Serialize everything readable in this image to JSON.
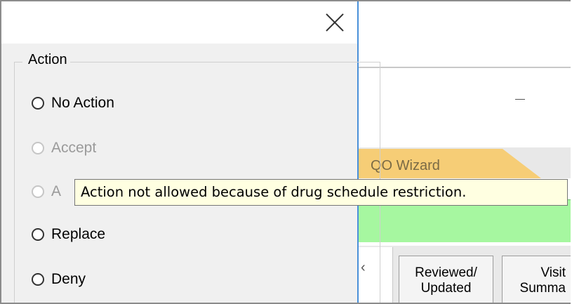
{
  "dialog": {
    "group_label": "Action",
    "options": [
      {
        "label": "No Action",
        "enabled": true
      },
      {
        "label": "Accept",
        "enabled": false
      },
      {
        "label": "A",
        "enabled": false
      },
      {
        "label": "Replace",
        "enabled": true
      },
      {
        "label": "Deny",
        "enabled": true
      }
    ],
    "close_icon": "close-icon"
  },
  "tooltip": {
    "text": "Action not allowed because of drug schedule restriction."
  },
  "background_app": {
    "minimize_icon": "minimize-icon",
    "wizard_tab": "QO Wizard",
    "left_chevron": "‹",
    "buttons": [
      {
        "line1": "Reviewed/",
        "line2": "Updated"
      },
      {
        "line1": "Visit",
        "line2": "Summa"
      }
    ]
  },
  "colors": {
    "dialog_bg": "#f0f0f0",
    "tooltip_bg": "#ffffe1",
    "wizard_tab": "#f6cd76",
    "status_bar_green": "#a6f7a0",
    "focus_border": "#4a90d9"
  }
}
